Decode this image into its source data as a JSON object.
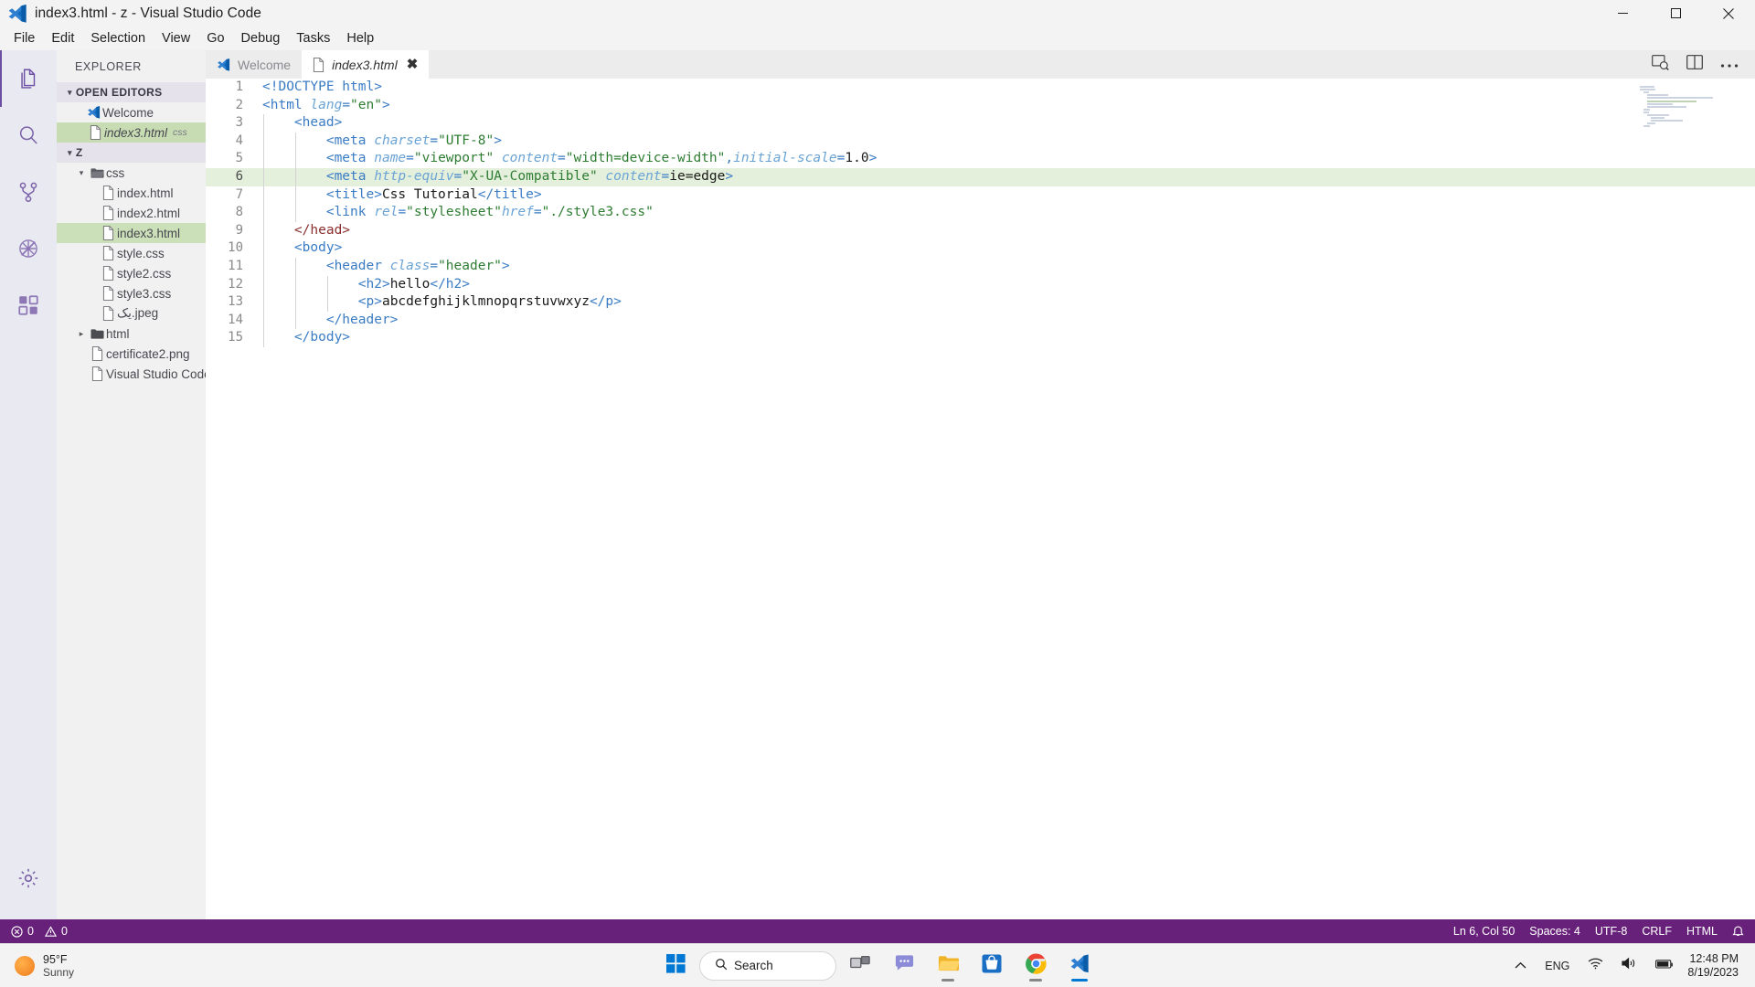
{
  "window": {
    "title": "index3.html - z - Visual Studio Code",
    "app_icon": "vscode-logo-icon",
    "minimize_label": "Minimize",
    "maximize_label": "Maximize",
    "close_label": "Close"
  },
  "menubar": {
    "items": [
      "File",
      "Edit",
      "Selection",
      "View",
      "Go",
      "Debug",
      "Tasks",
      "Help"
    ]
  },
  "activitybar": {
    "items": [
      {
        "name": "explorer",
        "label": "Explorer",
        "icon": "files-icon",
        "active": true
      },
      {
        "name": "search",
        "label": "Search",
        "icon": "search-icon",
        "active": false
      },
      {
        "name": "source-control",
        "label": "Source Control",
        "icon": "source-control-icon",
        "active": false
      },
      {
        "name": "run-debug",
        "label": "Run and Debug",
        "icon": "debug-disabled-icon",
        "active": false
      },
      {
        "name": "extensions",
        "label": "Extensions",
        "icon": "extensions-icon",
        "active": false
      }
    ],
    "bottom": [
      {
        "name": "manage",
        "label": "Manage",
        "icon": "gear-icon"
      }
    ]
  },
  "sidebar": {
    "title": "EXPLORER",
    "open_editors": {
      "label": "OPEN EDITORS",
      "twisty": "▾",
      "items": [
        {
          "label": "Welcome",
          "icon": "vscode-logo-icon",
          "italic": false,
          "selected": false,
          "badge": ""
        },
        {
          "label": "index3.html",
          "icon": "file-icon",
          "italic": true,
          "selected": true,
          "badge": "css"
        }
      ]
    },
    "workspace": {
      "label": "Z",
      "twisty": "▾",
      "items": [
        {
          "label": "css",
          "icon": "folder-open-icon",
          "type": "folder",
          "depth": 1,
          "twisty": "▾",
          "expanded": true,
          "selected": false
        },
        {
          "label": "index.html",
          "icon": "file-icon",
          "type": "file",
          "depth": 2,
          "selected": false
        },
        {
          "label": "index2.html",
          "icon": "file-icon",
          "type": "file",
          "depth": 2,
          "selected": false
        },
        {
          "label": "index3.html",
          "icon": "file-icon",
          "type": "file",
          "depth": 2,
          "selected": true
        },
        {
          "label": "style.css",
          "icon": "file-icon",
          "type": "file",
          "depth": 2,
          "selected": false
        },
        {
          "label": "style2.css",
          "icon": "file-icon",
          "type": "file",
          "depth": 2,
          "selected": false
        },
        {
          "label": "style3.css",
          "icon": "file-icon",
          "type": "file",
          "depth": 2,
          "selected": false
        },
        {
          "label": "یک.jpeg",
          "icon": "file-icon",
          "type": "file",
          "depth": 2,
          "selected": false
        },
        {
          "label": "html",
          "icon": "folder-icon",
          "type": "folder",
          "depth": 1,
          "twisty": "▸",
          "expanded": false,
          "selected": false
        },
        {
          "label": "certificate2.png",
          "icon": "file-icon",
          "type": "file",
          "depth": 1,
          "selected": false
        },
        {
          "label": "Visual Studio Code..",
          "icon": "file-icon",
          "type": "file",
          "depth": 1,
          "selected": false
        }
      ]
    }
  },
  "editor": {
    "tabs": [
      {
        "label": "Welcome",
        "icon": "vscode-logo-icon",
        "italic": false,
        "active": false,
        "closable": false
      },
      {
        "label": "index3.html",
        "icon": "file-icon",
        "italic": true,
        "active": true,
        "closable": true,
        "close_glyph": "✖"
      }
    ],
    "actions": [
      {
        "name": "open-preview-button",
        "icon": "open-preview-icon"
      },
      {
        "name": "split-editor-button",
        "icon": "split-editor-icon"
      },
      {
        "name": "more-actions-button",
        "icon": "ellipsis-icon"
      }
    ],
    "highlighted_line": 6,
    "lines": [
      {
        "n": 1,
        "indent": 0,
        "tokens": [
          {
            "c": "t-doc",
            "t": "<!DOCTYPE html>"
          }
        ]
      },
      {
        "n": 2,
        "indent": 0,
        "tokens": [
          {
            "c": "t-tag",
            "t": "<html "
          },
          {
            "c": "t-attr",
            "t": "lang"
          },
          {
            "c": "t-tag",
            "t": "="
          },
          {
            "c": "t-str",
            "t": "\"en\""
          },
          {
            "c": "t-tag",
            "t": ">"
          }
        ]
      },
      {
        "n": 3,
        "indent": 1,
        "tokens": [
          {
            "c": "t-tag",
            "t": "<head>"
          }
        ]
      },
      {
        "n": 4,
        "indent": 2,
        "tokens": [
          {
            "c": "t-tag",
            "t": "<meta "
          },
          {
            "c": "t-attr",
            "t": "charset"
          },
          {
            "c": "t-tag",
            "t": "="
          },
          {
            "c": "t-str",
            "t": "\"UTF-8\""
          },
          {
            "c": "t-tag",
            "t": ">"
          }
        ]
      },
      {
        "n": 5,
        "indent": 2,
        "tokens": [
          {
            "c": "t-tag",
            "t": "<meta "
          },
          {
            "c": "t-attr",
            "t": "name"
          },
          {
            "c": "t-tag",
            "t": "="
          },
          {
            "c": "t-str",
            "t": "\"viewport\""
          },
          {
            "c": "t-tag",
            "t": " "
          },
          {
            "c": "t-attr",
            "t": "content"
          },
          {
            "c": "t-tag",
            "t": "="
          },
          {
            "c": "t-str",
            "t": "\"width=device-width\""
          },
          {
            "c": "t-tag",
            "t": ","
          },
          {
            "c": "t-attr",
            "t": "initial-scale"
          },
          {
            "c": "t-tag",
            "t": "="
          },
          {
            "c": "t-val",
            "t": "1.0"
          },
          {
            "c": "t-tag",
            "t": ">"
          }
        ]
      },
      {
        "n": 6,
        "indent": 2,
        "tokens": [
          {
            "c": "t-tag",
            "t": "<meta "
          },
          {
            "c": "t-attr",
            "t": "http-equiv"
          },
          {
            "c": "t-tag",
            "t": "="
          },
          {
            "c": "t-str",
            "t": "\"X-UA-Compatible\""
          },
          {
            "c": "t-tag",
            "t": " "
          },
          {
            "c": "t-attr",
            "t": "content"
          },
          {
            "c": "t-tag",
            "t": "="
          },
          {
            "c": "t-val",
            "t": "ie=edge"
          },
          {
            "c": "t-tag",
            "t": ">"
          }
        ]
      },
      {
        "n": 7,
        "indent": 2,
        "tokens": [
          {
            "c": "t-tag",
            "t": "<title>"
          },
          {
            "c": "t-txt",
            "t": "Css Tutorial"
          },
          {
            "c": "t-tag",
            "t": "</title>"
          }
        ]
      },
      {
        "n": 8,
        "indent": 2,
        "tokens": [
          {
            "c": "t-tag",
            "t": "<link "
          },
          {
            "c": "t-attr",
            "t": "rel"
          },
          {
            "c": "t-tag",
            "t": "="
          },
          {
            "c": "t-str",
            "t": "\"stylesheet\""
          },
          {
            "c": "t-attr",
            "t": "href"
          },
          {
            "c": "t-tag",
            "t": "="
          },
          {
            "c": "t-str",
            "t": "\"./style3.css\""
          }
        ]
      },
      {
        "n": 9,
        "indent": 1,
        "tokens": [
          {
            "c": "t-close-head",
            "t": "</head>"
          }
        ]
      },
      {
        "n": 10,
        "indent": 1,
        "tokens": [
          {
            "c": "t-tag",
            "t": "<body>"
          }
        ]
      },
      {
        "n": 11,
        "indent": 2,
        "tokens": [
          {
            "c": "t-tag",
            "t": "<header "
          },
          {
            "c": "t-attr",
            "t": "class"
          },
          {
            "c": "t-tag",
            "t": "="
          },
          {
            "c": "t-str",
            "t": "\"header\""
          },
          {
            "c": "t-tag",
            "t": ">"
          }
        ]
      },
      {
        "n": 12,
        "indent": 3,
        "tokens": [
          {
            "c": "t-tag",
            "t": "<h2>"
          },
          {
            "c": "t-txt",
            "t": "hello"
          },
          {
            "c": "t-tag",
            "t": "</h2>"
          }
        ]
      },
      {
        "n": 13,
        "indent": 3,
        "tokens": [
          {
            "c": "t-tag",
            "t": "<p>"
          },
          {
            "c": "t-txt",
            "t": "abcdefghijklmnopqrstuvwxyz"
          },
          {
            "c": "t-tag",
            "t": "</p>"
          }
        ]
      },
      {
        "n": 14,
        "indent": 2,
        "tokens": [
          {
            "c": "t-tag",
            "t": "</header>"
          }
        ]
      },
      {
        "n": 15,
        "indent": 1,
        "tokens": [
          {
            "c": "t-tag",
            "t": "</body>"
          }
        ]
      }
    ]
  },
  "statusbar": {
    "background": "#68217a",
    "errors": "0",
    "warnings": "0",
    "error_icon": "error-circle-icon",
    "warning_icon": "warning-triangle-icon",
    "position": "Ln 6, Col 50",
    "indentation": "Spaces: 4",
    "encoding": "UTF-8",
    "eol": "CRLF",
    "language": "HTML"
  },
  "taskbar": {
    "weather": {
      "temperature": "95°F",
      "condition": "Sunny",
      "icon": "sun-icon"
    },
    "start_label": "Start",
    "search": {
      "placeholder": "Search",
      "icon": "search-icon"
    },
    "apps": [
      {
        "name": "start-button",
        "icon": "windows-logo-icon",
        "running": false
      },
      {
        "name": "search-pill",
        "icon": "search-icon",
        "running": false
      },
      {
        "name": "task-view-button",
        "icon": "task-view-icon",
        "running": false
      },
      {
        "name": "chat-button",
        "icon": "chat-icon",
        "running": false
      },
      {
        "name": "file-explorer-button",
        "icon": "folder-icon",
        "running": true
      },
      {
        "name": "microsoft-store-button",
        "icon": "store-icon",
        "running": false
      },
      {
        "name": "chrome-button",
        "icon": "chrome-icon",
        "running": true
      },
      {
        "name": "vscode-button",
        "icon": "vscode-logo-icon",
        "running": true,
        "active": true
      }
    ],
    "tray": {
      "expand_icon": "chevron-up-icon",
      "language": "ENG",
      "network_icon": "wifi-icon",
      "volume_icon": "speaker-icon",
      "battery_icon": "battery-icon",
      "time": "12:48 PM",
      "date": "8/19/2023"
    }
  }
}
